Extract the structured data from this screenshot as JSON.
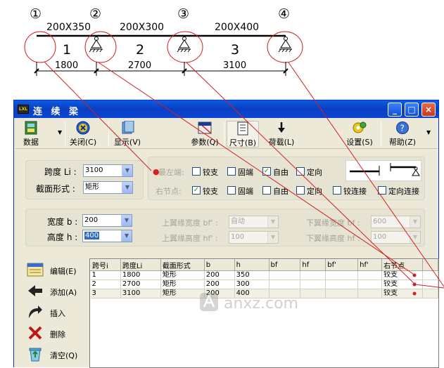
{
  "diagram": {
    "markers": [
      "①",
      "②",
      "③",
      "④"
    ],
    "spans": [
      {
        "section": "200X350",
        "index": "1",
        "length": "1800"
      },
      {
        "section": "200X300",
        "index": "2",
        "length": "2700"
      },
      {
        "section": "200X400",
        "index": "3",
        "length": "3100"
      }
    ]
  },
  "window": {
    "title": "连 续 梁",
    "icon_text": "LXL",
    "controls": {
      "minimize": "_",
      "maximize": "□",
      "close": "×"
    }
  },
  "toolbar": {
    "data": "数据",
    "close": "关闭(C)",
    "display": "显示(V)",
    "params": "参数(Q)",
    "size": "尺寸(B)",
    "load": "荷载(L)",
    "settings": "设置(S)",
    "help": "帮助(Z)"
  },
  "span_group": {
    "span_label": "跨度 Li :",
    "span_value": "3100",
    "section_label": "截面形式 :",
    "section_value": "矩形"
  },
  "ends": {
    "leftmost_label": "最左端:",
    "right_label": "右节点:",
    "leftmost_options": [
      {
        "label": "铰支",
        "checked": false
      },
      {
        "label": "固端",
        "checked": false
      },
      {
        "label": "自由",
        "checked": true
      },
      {
        "label": "定向",
        "checked": false
      }
    ],
    "right_options": [
      {
        "label": "铰支",
        "checked": true
      },
      {
        "label": "固端",
        "checked": false
      },
      {
        "label": "自由",
        "checked": false
      },
      {
        "label": "定向",
        "checked": false
      },
      {
        "label": "铰连接",
        "checked": false
      },
      {
        "label": "定向连接",
        "checked": false
      }
    ]
  },
  "dims": {
    "width_label": "宽度 b :",
    "width_value": "200",
    "height_label": "高度 h :",
    "height_value": "400",
    "top_flange_width_label": "上翼缘宽度 bf' :",
    "top_flange_width_value": "自动",
    "top_flange_height_label": "上翼缘高度 hf' :",
    "top_flange_height_value": "100",
    "bottom_flange_width_label": "下翼缘宽度 bf :",
    "bottom_flange_width_value": "600",
    "bottom_flange_height_label": "下翼缘高度 hf :",
    "bottom_flange_height_value": "100"
  },
  "commands": {
    "edit": "编辑(E)",
    "add": "添加(A)",
    "insert": "插入",
    "delete": "删除",
    "clear": "清空(Q)"
  },
  "grid": {
    "columns": [
      "跨号i",
      "跨度Li",
      "截面形式",
      "b",
      "h",
      "bf",
      "hf",
      "bf'",
      "hf'",
      "右节点"
    ],
    "rows": [
      [
        "1",
        "1800",
        "矩形",
        "200",
        "350",
        "",
        "",
        "",
        "",
        "铰支"
      ],
      [
        "2",
        "2700",
        "矩形",
        "200",
        "300",
        "",
        "",
        "",
        "",
        "铰支"
      ],
      [
        "3",
        "3100",
        "矩形",
        "200",
        "400",
        "",
        "",
        "",
        "",
        "铰支"
      ]
    ]
  },
  "watermark": "anxz.com",
  "colors": {
    "annotation": "#d42020",
    "titlebar": "#0a46d2",
    "window": "#ece9d8"
  }
}
